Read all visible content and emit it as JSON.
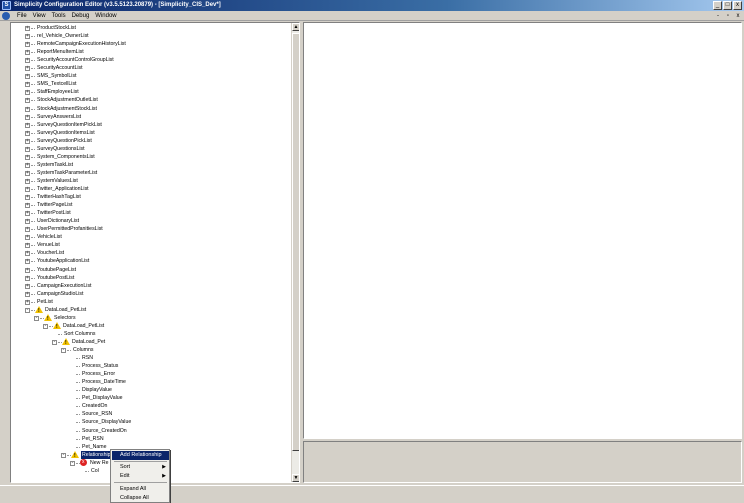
{
  "window": {
    "title": "Simplicity Configuration Editor (v3.5.5123.20879) - [Simplicity_CIS_Dev*]",
    "app_icon_letter": "S",
    "minimize": "_",
    "maximize": "□",
    "close": "x"
  },
  "menubar": {
    "items": [
      "File",
      "View",
      "Tools",
      "Debug",
      "Window"
    ],
    "mdi_min": "-",
    "mdi_restore": "▫",
    "mdi_close": "x"
  },
  "tree": {
    "nodes": [
      {
        "label": "ProductStockList",
        "level": 0,
        "expander": "+",
        "icon": "none"
      },
      {
        "label": "rel_Vehicle_OwnerList",
        "level": 0,
        "expander": "+",
        "icon": "none"
      },
      {
        "label": "RemoteCampaignExecutionHistoryList",
        "level": 0,
        "expander": "+",
        "icon": "none"
      },
      {
        "label": "ReportMenuItemList",
        "level": 0,
        "expander": "+",
        "icon": "none"
      },
      {
        "label": "SecurityAccountControlGroupList",
        "level": 0,
        "expander": "+",
        "icon": "none"
      },
      {
        "label": "SecurityAccountList",
        "level": 0,
        "expander": "+",
        "icon": "none"
      },
      {
        "label": "SMS_SymbolList",
        "level": 0,
        "expander": "+",
        "icon": "none"
      },
      {
        "label": "SMS_TextcellList",
        "level": 0,
        "expander": "+",
        "icon": "none"
      },
      {
        "label": "StaffEmployeeList",
        "level": 0,
        "expander": "+",
        "icon": "none"
      },
      {
        "label": "StockAdjustmentOutletList",
        "level": 0,
        "expander": "+",
        "icon": "none"
      },
      {
        "label": "StockAdjustmentStockList",
        "level": 0,
        "expander": "+",
        "icon": "none"
      },
      {
        "label": "SurveyAnswersList",
        "level": 0,
        "expander": "+",
        "icon": "none"
      },
      {
        "label": "SurveyQuestionItemPickList",
        "level": 0,
        "expander": "+",
        "icon": "none"
      },
      {
        "label": "SurveyQuestionItemsList",
        "level": 0,
        "expander": "+",
        "icon": "none"
      },
      {
        "label": "SurveyQuestionPickList",
        "level": 0,
        "expander": "+",
        "icon": "none"
      },
      {
        "label": "SurveyQuestionsList",
        "level": 0,
        "expander": "+",
        "icon": "none"
      },
      {
        "label": "System_ComponentsList",
        "level": 0,
        "expander": "+",
        "icon": "none"
      },
      {
        "label": "SystemTaskList",
        "level": 0,
        "expander": "+",
        "icon": "none"
      },
      {
        "label": "SystemTaskParameterList",
        "level": 0,
        "expander": "+",
        "icon": "none"
      },
      {
        "label": "SystemValuesList",
        "level": 0,
        "expander": "+",
        "icon": "none"
      },
      {
        "label": "Twitter_ApplicationList",
        "level": 0,
        "expander": "+",
        "icon": "none"
      },
      {
        "label": "TwitterHashTagList",
        "level": 0,
        "expander": "+",
        "icon": "none"
      },
      {
        "label": "TwitterPageList",
        "level": 0,
        "expander": "+",
        "icon": "none"
      },
      {
        "label": "TwitterPostList",
        "level": 0,
        "expander": "+",
        "icon": "none"
      },
      {
        "label": "UserDictionaryList",
        "level": 0,
        "expander": "+",
        "icon": "none"
      },
      {
        "label": "UserPermittedProfanitiesList",
        "level": 0,
        "expander": "+",
        "icon": "none"
      },
      {
        "label": "VehicleList",
        "level": 0,
        "expander": "+",
        "icon": "none"
      },
      {
        "label": "VenueList",
        "level": 0,
        "expander": "+",
        "icon": "none"
      },
      {
        "label": "VoucherList",
        "level": 0,
        "expander": "+",
        "icon": "none"
      },
      {
        "label": "YoutubeApplicationList",
        "level": 0,
        "expander": "+",
        "icon": "none"
      },
      {
        "label": "YoutubePageList",
        "level": 0,
        "expander": "+",
        "icon": "none"
      },
      {
        "label": "YoutubePostList",
        "level": 0,
        "expander": "+",
        "icon": "none"
      },
      {
        "label": "CampaignExecutionList",
        "level": 0,
        "expander": "+",
        "icon": "none"
      },
      {
        "label": "CampaignStudioList",
        "level": 0,
        "expander": "+",
        "icon": "none"
      },
      {
        "label": "PetList",
        "level": 0,
        "expander": "+",
        "icon": "none"
      },
      {
        "label": "DataLoad_PetList",
        "level": 0,
        "expander": "-",
        "icon": "warn"
      },
      {
        "label": "Selectors",
        "level": 1,
        "expander": "-",
        "icon": "warn"
      },
      {
        "label": "DataLoad_PetList",
        "level": 2,
        "expander": "-",
        "icon": "warn"
      },
      {
        "label": "Sort Columns",
        "level": 3,
        "expander": "",
        "icon": "none"
      },
      {
        "label": "DataLoad_Pet",
        "level": 3,
        "expander": "-",
        "icon": "warn"
      },
      {
        "label": "Columns",
        "level": 4,
        "expander": "-",
        "icon": "none"
      },
      {
        "label": "RSN",
        "level": 5,
        "expander": "",
        "icon": "none"
      },
      {
        "label": "Process_Status",
        "level": 5,
        "expander": "",
        "icon": "none"
      },
      {
        "label": "Process_Error",
        "level": 5,
        "expander": "",
        "icon": "none"
      },
      {
        "label": "Process_DateTime",
        "level": 5,
        "expander": "",
        "icon": "none"
      },
      {
        "label": "DisplayValue",
        "level": 5,
        "expander": "",
        "icon": "none"
      },
      {
        "label": "Pet_DisplayValue",
        "level": 5,
        "expander": "",
        "icon": "none"
      },
      {
        "label": "CreatedOn",
        "level": 5,
        "expander": "",
        "icon": "none"
      },
      {
        "label": "Source_RSN",
        "level": 5,
        "expander": "",
        "icon": "none"
      },
      {
        "label": "Source_DisplayValue",
        "level": 5,
        "expander": "",
        "icon": "none"
      },
      {
        "label": "Source_CreatedOn",
        "level": 5,
        "expander": "",
        "icon": "none"
      },
      {
        "label": "Pet_RSN",
        "level": 5,
        "expander": "",
        "icon": "none"
      },
      {
        "label": "Pet_Name",
        "level": 5,
        "expander": "",
        "icon": "none"
      },
      {
        "label": "Relationships",
        "level": 4,
        "expander": "-",
        "icon": "warn",
        "selected": true
      },
      {
        "label": "New Re",
        "level": 5,
        "expander": "-",
        "icon": "error"
      },
      {
        "label": "Col",
        "level": 6,
        "expander": "",
        "icon": "none"
      }
    ]
  },
  "scrollbar": {
    "up": "▲",
    "down": "▼"
  },
  "context_menu": {
    "items": [
      {
        "label": "Add Relationship",
        "highlighted": true,
        "submenu": false
      },
      {
        "label": "Sort",
        "highlighted": false,
        "submenu": true
      },
      {
        "label": "Edit",
        "highlighted": false,
        "submenu": true
      },
      {
        "label": "Expand All",
        "highlighted": false,
        "submenu": false
      },
      {
        "label": "Collapse All",
        "highlighted": false,
        "submenu": false
      }
    ],
    "submenu_arrow": "▶"
  },
  "colors": {
    "selection": "#0a246a",
    "warning": "#f2c200",
    "error": "#dd2222",
    "chrome": "#d4d0c8"
  }
}
